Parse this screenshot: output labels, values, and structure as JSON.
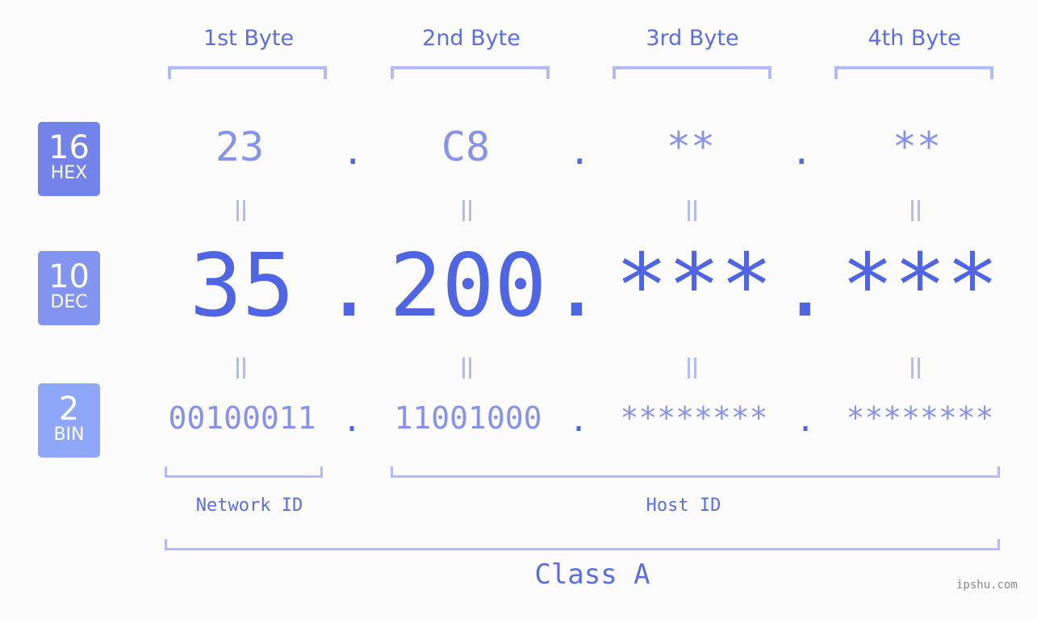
{
  "byte_headers": [
    "1st Byte",
    "2nd Byte",
    "3rd Byte",
    "4th Byte"
  ],
  "badges": [
    {
      "number": "16",
      "label": "HEX",
      "color": "#7383ea"
    },
    {
      "number": "10",
      "label": "DEC",
      "color": "#8393f0"
    },
    {
      "number": "2",
      "label": "BIN",
      "color": "#8fa7fa"
    }
  ],
  "hex": [
    "23",
    "C8",
    "**",
    "**"
  ],
  "dec": [
    "35",
    "200",
    "***",
    "***"
  ],
  "bin": [
    "00100011",
    "11001000",
    "********",
    "********"
  ],
  "separator": ".",
  "network_label": "Network ID",
  "host_label": "Host ID",
  "class_label": "Class A",
  "watermark": "ipshu.com",
  "colors": {
    "accent": "#4f65e3",
    "bracket": "#b3bbf7",
    "light_text": "#8692ec"
  }
}
